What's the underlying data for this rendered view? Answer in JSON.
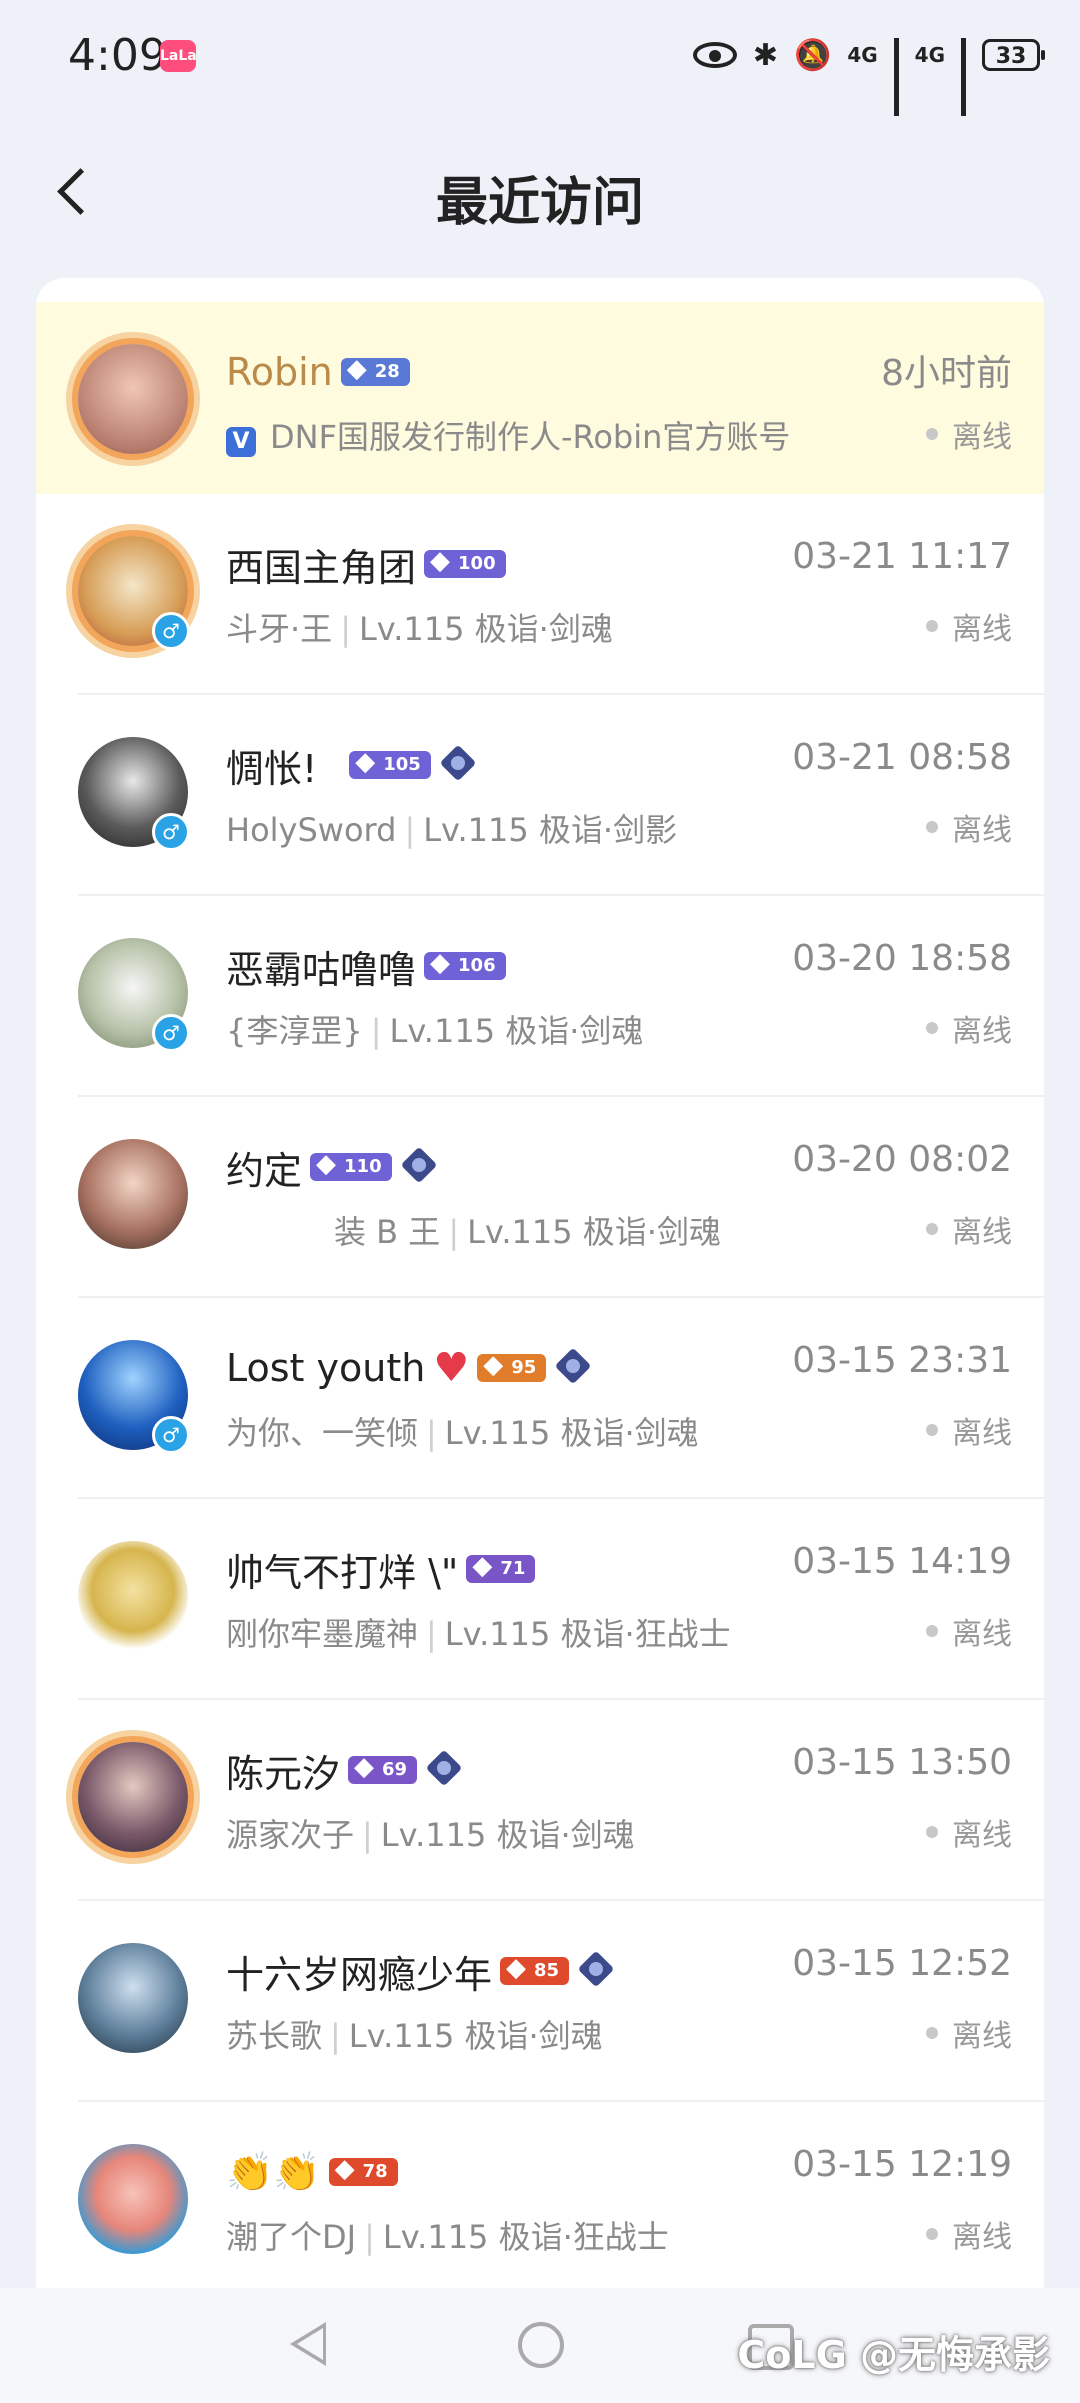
{
  "status_bar": {
    "time": "4:09",
    "app_badge": "LaLa",
    "network1": "4G",
    "network2": "4G",
    "battery": "33"
  },
  "header": {
    "title": "最近访问"
  },
  "visitors": [
    {
      "name": "Robin",
      "badge": "28",
      "desc": "DNF国服发行制作人-Robin官方账号",
      "time": "8小时前",
      "status": "离线"
    },
    {
      "name": "西国主角团",
      "badge": "100",
      "prefix": "斗牙·王",
      "desc": "Lv.115 极诣·剑魂",
      "time": "03-21 11:17",
      "status": "离线"
    },
    {
      "name": "惆怅!",
      "badge": "105",
      "prefix": "HolySword",
      "desc": "Lv.115 极诣·剑影",
      "time": "03-21 08:58",
      "status": "离线"
    },
    {
      "name": "恶霸咕噜噜",
      "badge": "106",
      "prefix": "{李淳罡}",
      "desc": "Lv.115 极诣·剑魂",
      "time": "03-20 18:58",
      "status": "离线"
    },
    {
      "name": "约定",
      "badge": "110",
      "prefix": "装 B 王",
      "desc": "Lv.115 极诣·剑魂",
      "time": "03-20 08:02",
      "status": "离线"
    },
    {
      "name": "Lost youth",
      "badge": "95",
      "prefix": "为你、一笑倾",
      "desc": "Lv.115 极诣·剑魂",
      "time": "03-15 23:31",
      "status": "离线"
    },
    {
      "name": "帅气不打烊 \\\"",
      "badge": "71",
      "prefix": "刚你牢墨魔神",
      "desc": "Lv.115 极诣·狂战士",
      "time": "03-15 14:19",
      "status": "离线"
    },
    {
      "name": "陈元汐",
      "badge": "69",
      "prefix": "源家次子",
      "desc": "Lv.115 极诣·剑魂",
      "time": "03-15 13:50",
      "status": "离线"
    },
    {
      "name": "十六岁网瘾少年",
      "badge": "85",
      "prefix": "苏长歌",
      "desc": "Lv.115 极诣·剑魂",
      "time": "03-15 12:52",
      "status": "离线"
    },
    {
      "name": "👏👏",
      "badge": "78",
      "prefix": "潮了个DJ",
      "desc": "Lv.115 极诣·狂战士",
      "time": "03-15 12:19",
      "status": "离线"
    }
  ],
  "watermark": "CoLG @无悔承影",
  "colors": {
    "background": "#eef1f7",
    "highlight_row": "#fffbdf",
    "gold_name": "#b98a4a",
    "gender_badge": "#2aa2e6"
  }
}
